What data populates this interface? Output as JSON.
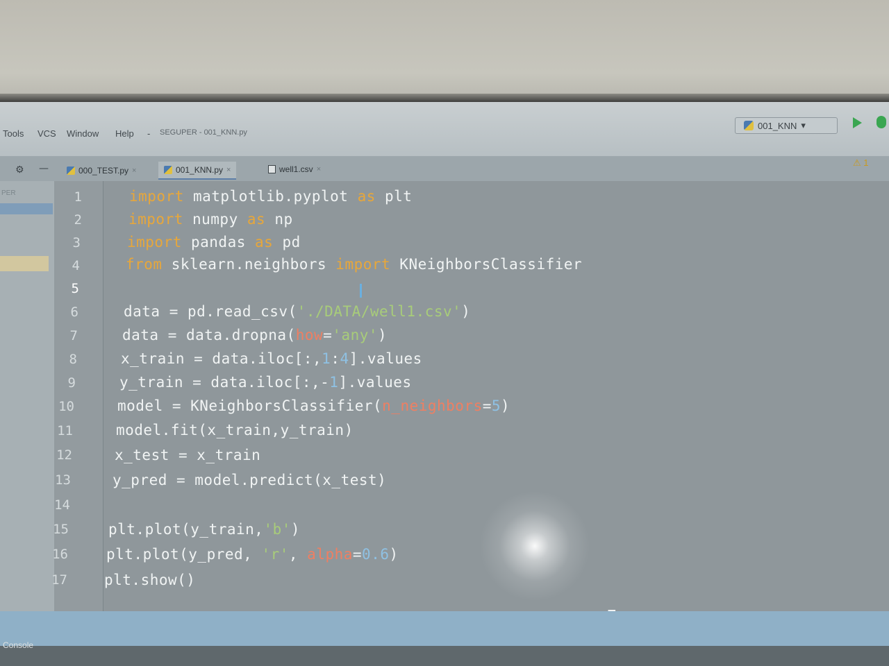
{
  "menu": {
    "items": [
      "Tools",
      "VCS",
      "Window",
      "Help"
    ],
    "separator": "-",
    "project_title": "SEGUPER - 001_KNN.py"
  },
  "run_config": {
    "label": "001_KNN",
    "chevron": "▾"
  },
  "tabs": [
    {
      "label": "000_TEST.py",
      "close": "×",
      "icon": "python-file-icon"
    },
    {
      "label": "001_KNN.py",
      "close": "×",
      "icon": "python-file-icon",
      "active": true
    },
    {
      "label": "well1.csv",
      "close": "×",
      "icon": "csv-file-icon"
    }
  ],
  "warnings": {
    "symbol": "⚠",
    "count": "1"
  },
  "project_panel": {
    "label": "PER"
  },
  "editor": {
    "current_line": "5",
    "lines": [
      {
        "no": "1",
        "text": "import matplotlib.pyplot as plt"
      },
      {
        "no": "2",
        "text": "import numpy as np"
      },
      {
        "no": "3",
        "text": "import pandas as pd"
      },
      {
        "no": "4",
        "text": "from sklearn.neighbors import KNeighborsClassifier"
      },
      {
        "no": "5",
        "text": ""
      },
      {
        "no": "6",
        "text": "data = pd.read_csv('./DATA/well1.csv')"
      },
      {
        "no": "7",
        "text": "data = data.dropna(how='any')"
      },
      {
        "no": "8",
        "text": "x_train = data.iloc[:,1:4].values"
      },
      {
        "no": "9",
        "text": "y_train = data.iloc[:,-1].values"
      },
      {
        "no": "10",
        "text": "model = KNeighborsClassifier(n_neighbors=5)"
      },
      {
        "no": "11",
        "text": "model.fit(x_train,y_train)"
      },
      {
        "no": "12",
        "text": "x_test = x_train"
      },
      {
        "no": "13",
        "text": "y_pred = model.predict(x_test)"
      },
      {
        "no": "14",
        "text": ""
      },
      {
        "no": "15",
        "text": "plt.plot(y_train,'b')"
      },
      {
        "no": "16",
        "text": "plt.plot(y_pred, 'r', alpha=0.6)"
      },
      {
        "no": "17",
        "text": "plt.show()"
      }
    ]
  },
  "bottom": {
    "console_label": "Console"
  },
  "colors": {
    "keyword": "#e8a73a",
    "string": "#a8cc7a",
    "number": "#8fc1e3",
    "param": "#ef7f62",
    "run_green": "#3aa651"
  }
}
